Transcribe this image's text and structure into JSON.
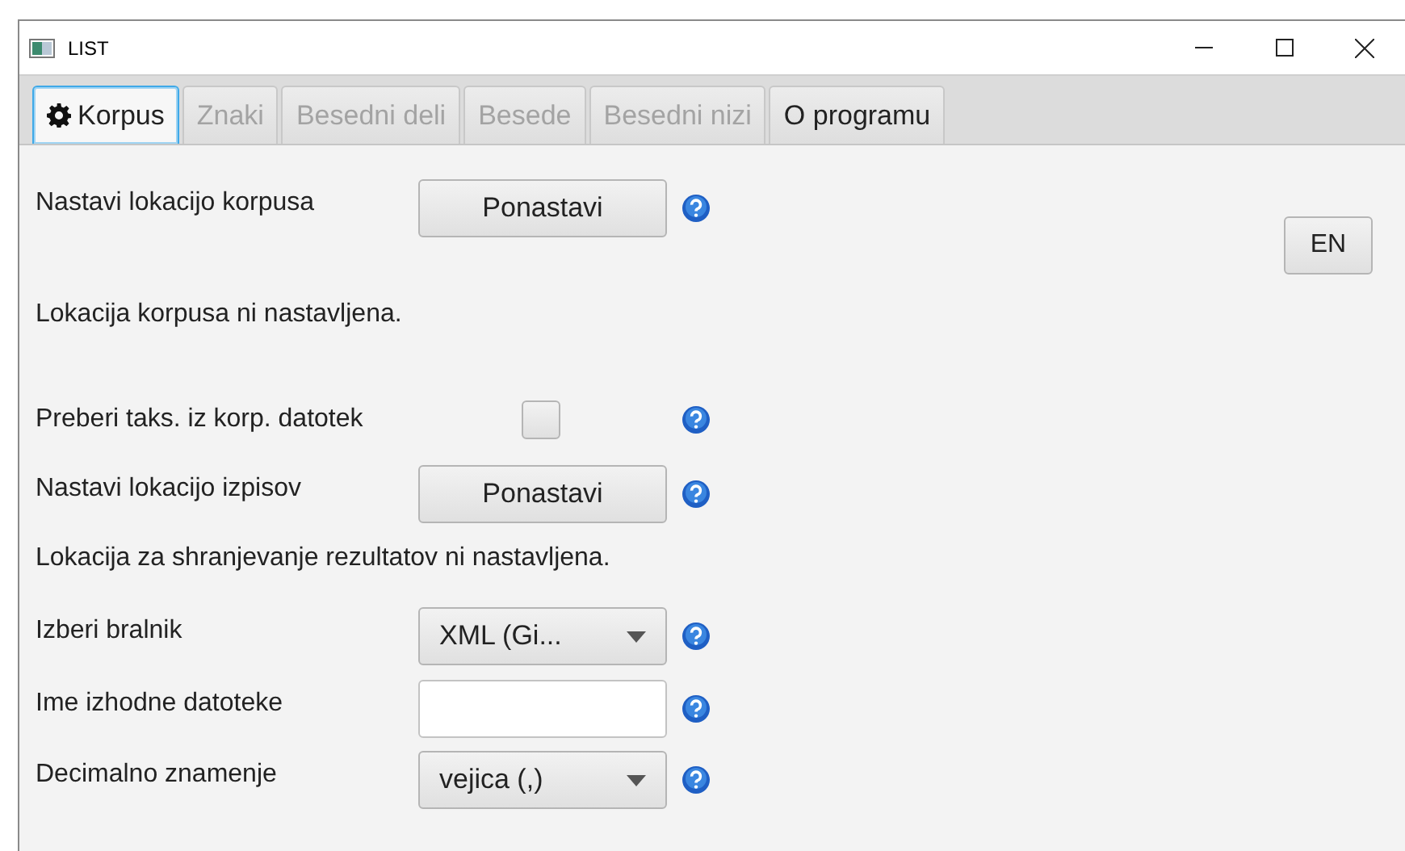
{
  "window": {
    "title": "LIST"
  },
  "tabs": [
    {
      "label": "Korpus",
      "selected": true,
      "disabled": false,
      "icon": true
    },
    {
      "label": "Znaki",
      "selected": false,
      "disabled": true,
      "icon": false
    },
    {
      "label": "Besedni deli",
      "selected": false,
      "disabled": true,
      "icon": false
    },
    {
      "label": "Besede",
      "selected": false,
      "disabled": true,
      "icon": false
    },
    {
      "label": "Besedni nizi",
      "selected": false,
      "disabled": true,
      "icon": false
    },
    {
      "label": "O programu",
      "selected": false,
      "disabled": false,
      "icon": false
    }
  ],
  "language_button": "EN",
  "rows": [
    {
      "kind": "button",
      "label": "Nastavi lokacijo korpusa",
      "value": "Ponastavi"
    },
    {
      "kind": "message",
      "label": "Lokacija korpusa ni nastavljena."
    },
    {
      "kind": "checkbox",
      "label": "Preberi taks. iz korp. datotek",
      "checked": false
    },
    {
      "kind": "button",
      "label": "Nastavi lokacijo izpisov",
      "value": "Ponastavi"
    },
    {
      "kind": "message",
      "label": "Lokacija za shranjevanje rezultatov ni nastavljena."
    },
    {
      "kind": "select",
      "label": "Izberi bralnik",
      "value": "XML (Gi..."
    },
    {
      "kind": "input",
      "label": "Ime izhodne datoteke",
      "value": ""
    },
    {
      "kind": "select",
      "label": "Decimalno znamenje",
      "value": "vejica (,)"
    }
  ]
}
